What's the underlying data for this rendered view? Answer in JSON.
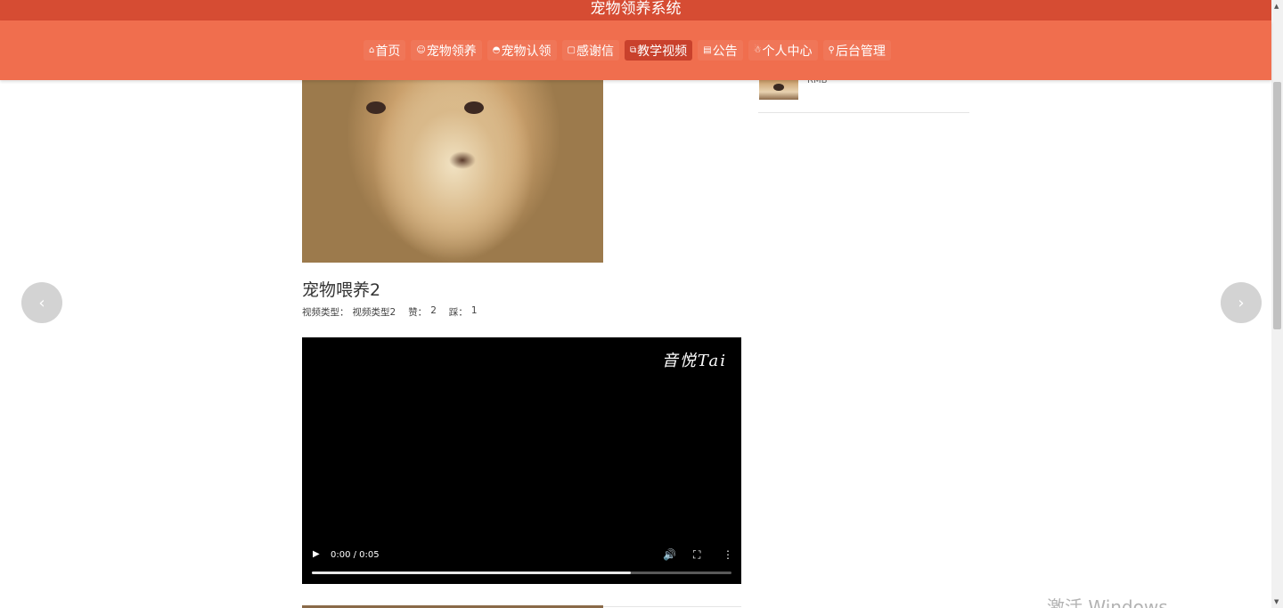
{
  "header": {
    "site_title": "宠物领养系统"
  },
  "nav": {
    "items": [
      {
        "icon": "⌂",
        "label": "首页"
      },
      {
        "icon": "☺",
        "label": "宠物领养"
      },
      {
        "icon": "◓",
        "label": "宠物认领"
      },
      {
        "icon": "▢",
        "label": "感谢信"
      },
      {
        "icon": "⧉",
        "label": "教学视频"
      },
      {
        "icon": "▤",
        "label": "公告"
      },
      {
        "icon": "☃",
        "label": "个人中心"
      },
      {
        "icon": "⚲",
        "label": "后台管理"
      }
    ],
    "active_index": 4
  },
  "video": {
    "title": "宠物喂养2",
    "type_label": "视频类型：",
    "type_value": "视频类型2",
    "like_label": "赞：",
    "like_value": "2",
    "dislike_label": "踩：",
    "dislike_value": "1",
    "watermark": "音悦Tai",
    "time_display": "0:00 / 0:05",
    "progress_fraction": 0.76
  },
  "sidebar": {
    "item_label": "RMB"
  },
  "carousel": {
    "prev_icon": "‹",
    "next_icon": "›"
  },
  "os_watermark": "激活 Windows",
  "colors": {
    "topbar": "#d64c33",
    "navbar": "#f06e4e",
    "nav_active": "#c9412c"
  }
}
